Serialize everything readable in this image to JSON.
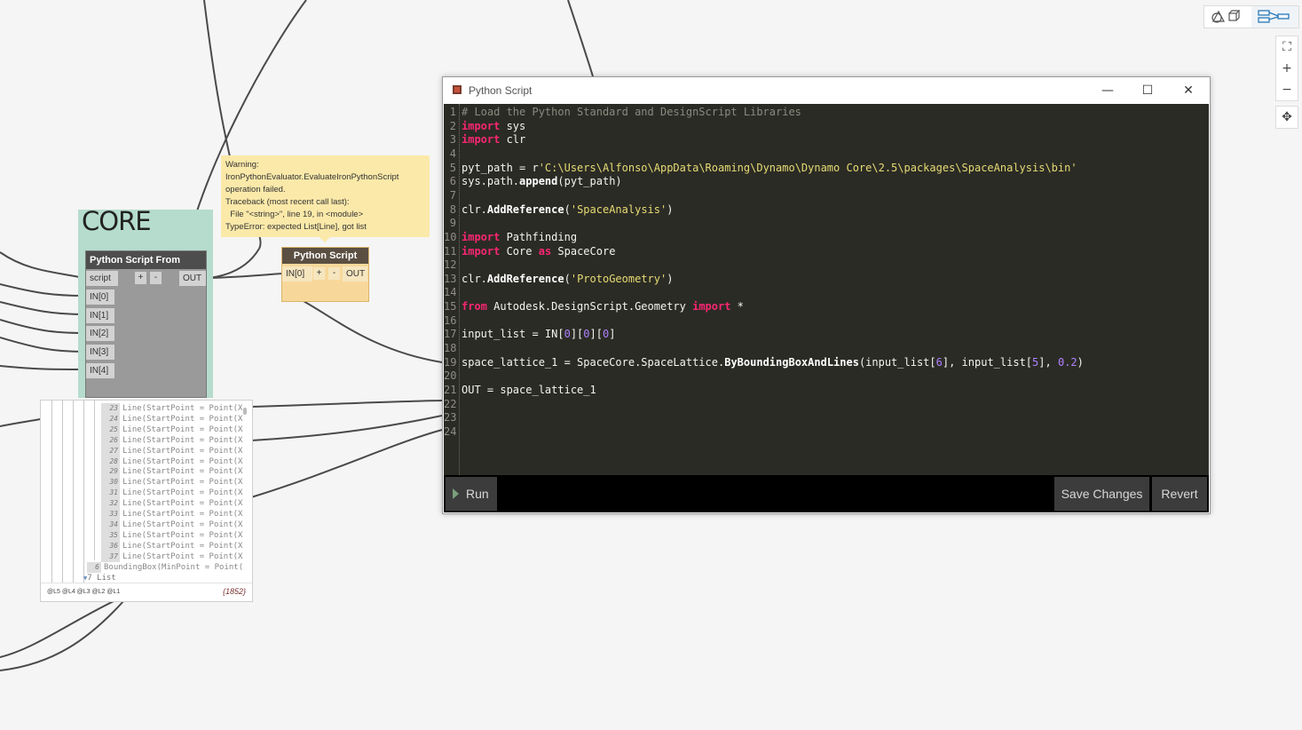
{
  "group": {
    "title": "CORE",
    "color": "#b5dccd"
  },
  "node_from_string": {
    "title": "Python Script From String",
    "inputs": [
      "script",
      "IN[0]",
      "IN[1]",
      "IN[2]",
      "IN[3]",
      "IN[4]"
    ],
    "add_label": "+",
    "remove_label": "-",
    "output": "OUT"
  },
  "warning": {
    "lines": [
      "Warning:",
      "IronPythonEvaluator.EvaluateIronPythonScript",
      "operation failed.",
      "Traceback (most recent call last):",
      "  File \"<string>\", line 19, in <module>",
      "TypeError: expected List[Line], got list"
    ],
    "color": "#fbe9a9"
  },
  "node_python": {
    "title": "Python Script",
    "input": "IN[0]",
    "add_label": "+",
    "remove_label": "-",
    "output": "OUT",
    "color": "#f8d89a"
  },
  "preview": {
    "rows": [
      {
        "index": "23",
        "text": "Line(StartPoint = Point(X"
      },
      {
        "index": "24",
        "text": "Line(StartPoint = Point(X"
      },
      {
        "index": "25",
        "text": "Line(StartPoint = Point(X"
      },
      {
        "index": "26",
        "text": "Line(StartPoint = Point(X"
      },
      {
        "index": "27",
        "text": "Line(StartPoint = Point(X"
      },
      {
        "index": "28",
        "text": "Line(StartPoint = Point(X"
      },
      {
        "index": "29",
        "text": "Line(StartPoint = Point(X"
      },
      {
        "index": "30",
        "text": "Line(StartPoint = Point(X"
      },
      {
        "index": "31",
        "text": "Line(StartPoint = Point(X"
      },
      {
        "index": "32",
        "text": "Line(StartPoint = Point(X"
      },
      {
        "index": "33",
        "text": "Line(StartPoint = Point(X"
      },
      {
        "index": "34",
        "text": "Line(StartPoint = Point(X"
      },
      {
        "index": "35",
        "text": "Line(StartPoint = Point(X"
      },
      {
        "index": "36",
        "text": "Line(StartPoint = Point(X"
      },
      {
        "index": "37",
        "text": "Line(StartPoint = Point(X"
      }
    ],
    "bbox_index": "6",
    "bbox_text": "BoundingBox(MinPoint = Point(",
    "list_label": "7 List",
    "levels": "@L5 @L4 @L3 @L2 @L1",
    "count": "{1852}"
  },
  "editor_window": {
    "title": "Python Script",
    "minimize_label": "—",
    "maximize_label": "☐",
    "close_label": "✕",
    "run_label": "Run",
    "save_label": "Save Changes",
    "revert_label": "Revert",
    "code_lines": [
      [
        {
          "t": "# Load the Python Standard and DesignScript Libraries",
          "c": "c-com"
        }
      ],
      [
        {
          "t": "import",
          "c": "c-kw"
        },
        {
          "t": " sys",
          "c": ""
        }
      ],
      [
        {
          "t": "import",
          "c": "c-kw"
        },
        {
          "t": " clr",
          "c": ""
        }
      ],
      [],
      [
        {
          "t": "pyt_path = r",
          "c": ""
        },
        {
          "t": "'C:\\Users\\Alfonso\\AppData\\Roaming\\Dynamo\\Dynamo Core\\2.5\\packages\\SpaceAnalysis\\bin'",
          "c": "c-str"
        }
      ],
      [
        {
          "t": "sys.path.",
          "c": ""
        },
        {
          "t": "append",
          "c": "c-fn"
        },
        {
          "t": "(pyt_path)",
          "c": ""
        }
      ],
      [],
      [
        {
          "t": "clr.",
          "c": ""
        },
        {
          "t": "AddReference",
          "c": "c-fn"
        },
        {
          "t": "(",
          "c": ""
        },
        {
          "t": "'SpaceAnalysis'",
          "c": "c-str"
        },
        {
          "t": ")",
          "c": ""
        }
      ],
      [],
      [
        {
          "t": "import",
          "c": "c-kw"
        },
        {
          "t": " Pathfinding",
          "c": ""
        }
      ],
      [
        {
          "t": "import",
          "c": "c-kw"
        },
        {
          "t": " Core ",
          "c": ""
        },
        {
          "t": "as",
          "c": "c-kw"
        },
        {
          "t": " SpaceCore",
          "c": ""
        }
      ],
      [],
      [
        {
          "t": "clr.",
          "c": ""
        },
        {
          "t": "AddReference",
          "c": "c-fn"
        },
        {
          "t": "(",
          "c": ""
        },
        {
          "t": "'ProtoGeometry'",
          "c": "c-str"
        },
        {
          "t": ")",
          "c": ""
        }
      ],
      [],
      [
        {
          "t": "from",
          "c": "c-kw"
        },
        {
          "t": " Autodesk.DesignScript.Geometry ",
          "c": ""
        },
        {
          "t": "import",
          "c": "c-kw"
        },
        {
          "t": " *",
          "c": ""
        }
      ],
      [],
      [
        {
          "t": "input_list = IN[",
          "c": ""
        },
        {
          "t": "0",
          "c": "c-num"
        },
        {
          "t": "][",
          "c": ""
        },
        {
          "t": "0",
          "c": "c-num"
        },
        {
          "t": "][",
          "c": ""
        },
        {
          "t": "0",
          "c": "c-num"
        },
        {
          "t": "]",
          "c": ""
        }
      ],
      [],
      [
        {
          "t": "space_lattice_1 = SpaceCore.SpaceLattice.",
          "c": ""
        },
        {
          "t": "ByBoundingBoxAndLines",
          "c": "c-fn"
        },
        {
          "t": "(input_list[",
          "c": ""
        },
        {
          "t": "6",
          "c": "c-num"
        },
        {
          "t": "], input_list[",
          "c": ""
        },
        {
          "t": "5",
          "c": "c-num"
        },
        {
          "t": "], ",
          "c": ""
        },
        {
          "t": "0.2",
          "c": "c-num"
        },
        {
          "t": ")",
          "c": ""
        }
      ],
      [],
      [
        {
          "t": "OUT = space_lattice_1",
          "c": ""
        }
      ],
      [],
      [],
      []
    ]
  },
  "canvas_controls": {
    "zoom_fit_label": "⛶",
    "zoom_in_label": "+",
    "zoom_out_label": "−",
    "pan_label": "✥"
  }
}
